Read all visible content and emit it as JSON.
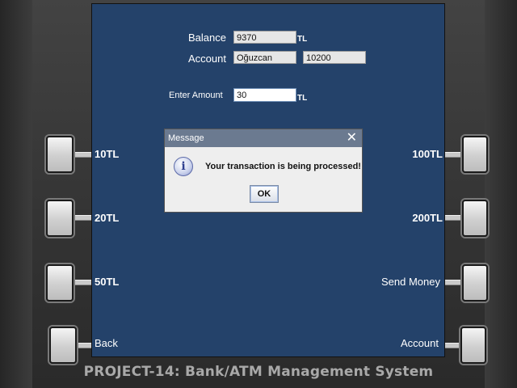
{
  "footer_title": "PROJECT-14: Bank/ATM Management System",
  "screen": {
    "balance_label": "Balance",
    "balance_value": "9370",
    "balance_unit": "TL",
    "account_label": "Account",
    "account_name": "Oğuzcan",
    "account_number": "10200",
    "amount_label": "Enter Amount",
    "amount_value": "30",
    "amount_unit": "TL"
  },
  "left_buttons": [
    "10TL",
    "20TL",
    "50TL",
    "Back"
  ],
  "right_buttons": [
    "100TL",
    "200TL",
    "Send Money",
    "Account"
  ],
  "dialog": {
    "title": "Message",
    "message": "Your transaction is being processed!",
    "ok_label": "OK",
    "icon": "info-icon"
  },
  "colors": {
    "screen_bg": "#24426a",
    "dialog_title_bg": "#6b7a90"
  }
}
